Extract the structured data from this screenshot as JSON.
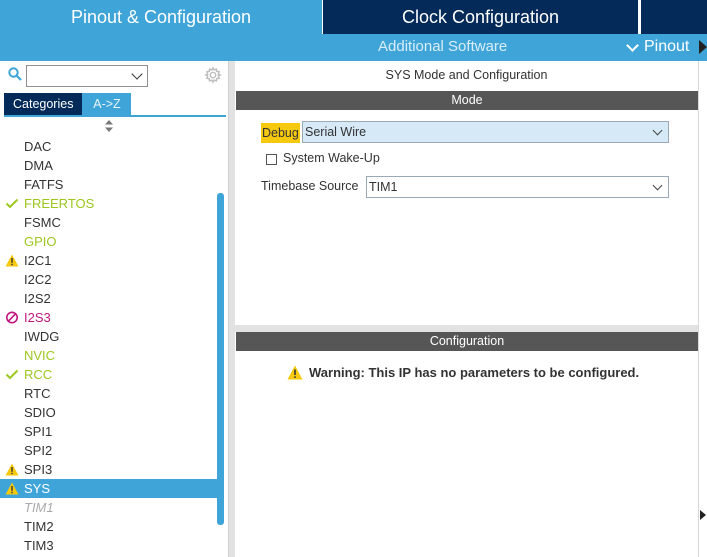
{
  "tabs": {
    "pinout": "Pinout & Configuration",
    "clock": "Clock Configuration"
  },
  "subbar": {
    "additional": "Additional Software",
    "pinout": "Pinout"
  },
  "left": {
    "search_value": "",
    "categories_tab": "Categories",
    "az_tab": "A->Z",
    "items": [
      {
        "label": "DAC",
        "status": "none"
      },
      {
        "label": "DMA",
        "status": "none"
      },
      {
        "label": "FATFS",
        "status": "none"
      },
      {
        "label": "FREERTOS",
        "status": "check"
      },
      {
        "label": "FSMC",
        "status": "none"
      },
      {
        "label": "GPIO",
        "status": "green"
      },
      {
        "label": "I2C1",
        "status": "warning"
      },
      {
        "label": "I2C2",
        "status": "none"
      },
      {
        "label": "I2S2",
        "status": "none"
      },
      {
        "label": "I2S3",
        "status": "disabled"
      },
      {
        "label": "IWDG",
        "status": "none"
      },
      {
        "label": "NVIC",
        "status": "green"
      },
      {
        "label": "RCC",
        "status": "check"
      },
      {
        "label": "RTC",
        "status": "none"
      },
      {
        "label": "SDIO",
        "status": "none"
      },
      {
        "label": "SPI1",
        "status": "none"
      },
      {
        "label": "SPI2",
        "status": "none"
      },
      {
        "label": "SPI3",
        "status": "warning"
      },
      {
        "label": "SYS",
        "status": "warning-selected"
      },
      {
        "label": "TIM1",
        "status": "unavailable"
      },
      {
        "label": "TIM2",
        "status": "none"
      },
      {
        "label": "TIM3",
        "status": "none"
      }
    ]
  },
  "mode_panel": {
    "title": "SYS Mode and Configuration",
    "mode_header": "Mode",
    "debug_label": "Debug",
    "debug_value": "Serial Wire",
    "wakeup_label": "System Wake-Up",
    "timebase_label": "Timebase Source",
    "timebase_value": "TIM1"
  },
  "config_panel": {
    "header": "Configuration",
    "warning": "Warning: This IP has no parameters to be configured."
  },
  "colors": {
    "accent": "#3fa5d8",
    "navy": "#032a58",
    "green": "#9cc71f",
    "warning": "#f6c90f",
    "magenta": "#c0177e"
  }
}
